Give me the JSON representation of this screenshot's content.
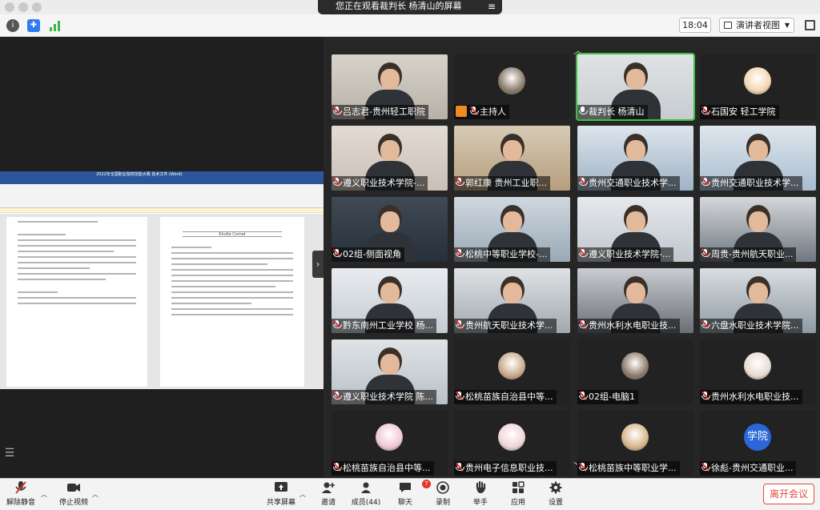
{
  "window": {
    "share_banner": "您正在观看裁判长  杨清山的屏幕",
    "banner_menu_icon": "hamburger-icon"
  },
  "toolbar": {
    "info_icon": "info-icon",
    "security_icon": "shield-icon",
    "signal_icon": "signal-bars-icon",
    "time": "18:04",
    "view_label": "演讲者视图",
    "fullscreen_icon": "fullscreen-icon"
  },
  "shared_doc": {
    "app_title": "2022年全国职业院校技能大赛 技术文件 (Word)",
    "heading_right": "Kindle Comet"
  },
  "gallery": {
    "tiles": [
      {
        "name": "吕志君-贵州轻工职院"
      },
      {
        "name": "主持人",
        "host": true
      },
      {
        "name": "裁判长  杨清山",
        "mic_on": true
      },
      {
        "name": "石国安  轻工学院"
      },
      {
        "name": "遵义职业技术学院-..."
      },
      {
        "name": "郭红康    贵州工业职..."
      },
      {
        "name": "贵州交通职业技术学..."
      },
      {
        "name": "贵州交通职业技术学..."
      },
      {
        "name": "02组-侧面视角"
      },
      {
        "name": "松桃中等职业学校-..."
      },
      {
        "name": "遵义职业技术学院-..."
      },
      {
        "name": "周贵-贵州航天职业..."
      },
      {
        "name": "黔东南州工业学校  杨..."
      },
      {
        "name": "贵州航天职业技术学..."
      },
      {
        "name": "贵州水利水电职业技..."
      },
      {
        "name": "六盘水职业技术学院..."
      },
      {
        "name": "遵义职业技术学院  陈..."
      },
      {
        "name": "松桃苗族自治县中等..."
      },
      {
        "name": "02组-电脑1"
      },
      {
        "name": "贵州水利水电职业技..."
      },
      {
        "name": "松桃苗族自治县中等..."
      },
      {
        "name": "贵州电子信息职业技..."
      },
      {
        "name": "松桃苗族中等职业学..."
      },
      {
        "name": "徐彪-贵州交通职业...",
        "text_avatar": "学院"
      }
    ]
  },
  "bottom": {
    "unmute": "解除静音",
    "stop_video": "停止视频",
    "share_screen": "共享屏幕",
    "invite": "邀请",
    "participants": "成员(44)",
    "chat": "聊天",
    "chat_badge": "7",
    "record": "录制",
    "raise_hand": "举手",
    "apps": "应用",
    "settings": "设置",
    "leave": "离开会议"
  }
}
